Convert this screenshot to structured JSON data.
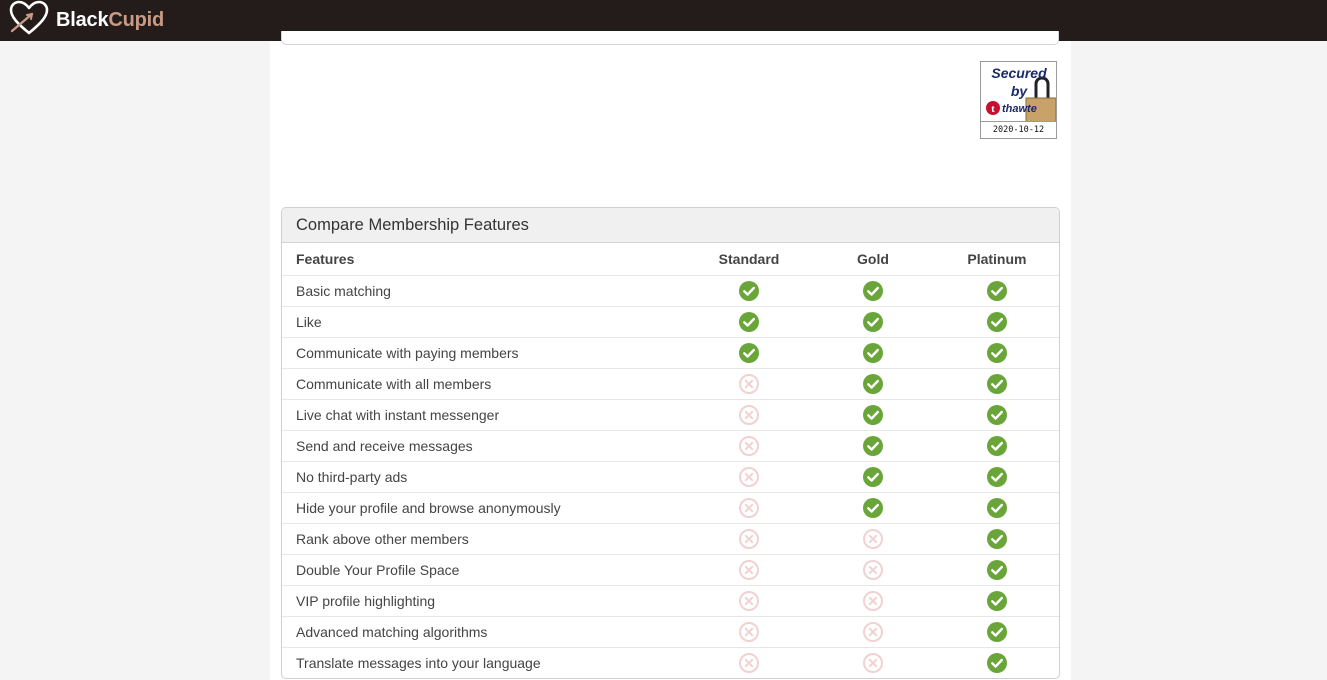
{
  "header": {
    "brand_part1": "Black",
    "brand_part2": "Cupid",
    "logo_icon": "heart-logo-icon"
  },
  "seal": {
    "line1": "Secured",
    "line2": "by",
    "brand": "thawte",
    "date": "2020-10-12"
  },
  "compare": {
    "title": "Compare Membership Features",
    "columns": [
      "Features",
      "Standard",
      "Gold",
      "Platinum"
    ],
    "rows": [
      {
        "feature": "Basic matching",
        "standard": true,
        "gold": true,
        "platinum": true
      },
      {
        "feature": "Like",
        "standard": true,
        "gold": true,
        "platinum": true
      },
      {
        "feature": "Communicate with paying members",
        "standard": true,
        "gold": true,
        "platinum": true
      },
      {
        "feature": "Communicate with all members",
        "standard": false,
        "gold": true,
        "platinum": true
      },
      {
        "feature": "Live chat with instant messenger",
        "standard": false,
        "gold": true,
        "platinum": true
      },
      {
        "feature": "Send and receive messages",
        "standard": false,
        "gold": true,
        "platinum": true
      },
      {
        "feature": "No third-party ads",
        "standard": false,
        "gold": true,
        "platinum": true
      },
      {
        "feature": "Hide your profile and browse anonymously",
        "standard": false,
        "gold": true,
        "platinum": true
      },
      {
        "feature": "Rank above other members",
        "standard": false,
        "gold": false,
        "platinum": true
      },
      {
        "feature": "Double Your Profile Space",
        "standard": false,
        "gold": false,
        "platinum": true
      },
      {
        "feature": "VIP profile highlighting",
        "standard": false,
        "gold": false,
        "platinum": true
      },
      {
        "feature": "Advanced matching algorithms",
        "standard": false,
        "gold": false,
        "platinum": true
      },
      {
        "feature": "Translate messages into your language",
        "standard": false,
        "gold": false,
        "platinum": true
      }
    ]
  },
  "icons": {
    "included": "check-circle-icon",
    "excluded": "x-circle-icon"
  },
  "colors": {
    "topbar": "#231c1a",
    "brand_accent": "#c99a86",
    "check": "#6aa53a",
    "cross": "#f1d1d1"
  }
}
